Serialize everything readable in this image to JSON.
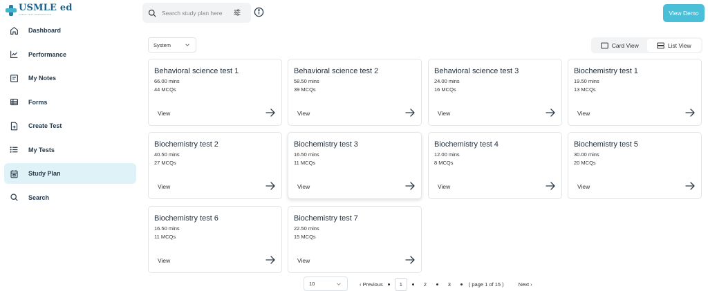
{
  "app": {
    "logo_text": "USMLE ed",
    "logo_tagline": "USMLE TEST PREPARATION"
  },
  "sidebar": {
    "items": [
      {
        "label": "Dashboard",
        "icon": "home-icon"
      },
      {
        "label": "Performance",
        "icon": "chart-line-icon"
      },
      {
        "label": "My Notes",
        "icon": "notes-icon"
      },
      {
        "label": "Forms",
        "icon": "table-icon"
      },
      {
        "label": "Create Test",
        "icon": "file-plus-icon"
      },
      {
        "label": "My Tests",
        "icon": "list-icon"
      },
      {
        "label": "Study Plan",
        "icon": "calendar-icon",
        "active": true
      },
      {
        "label": "Search",
        "icon": "search-icon"
      }
    ]
  },
  "header": {
    "search_placeholder": "Search study plan here",
    "demo_button": "View Demo"
  },
  "filters": {
    "system_value": "System",
    "card_view_label": "Card View",
    "list_view_label": "List View",
    "active_view": "List View"
  },
  "cards": [
    {
      "title": "Behavioral science test 1",
      "mins": "66.00 mins",
      "mcqs": "44 MCQs",
      "action": "View"
    },
    {
      "title": "Behavioral science test 2",
      "mins": "58.50 mins",
      "mcqs": "39 MCQs",
      "action": "View"
    },
    {
      "title": "Behavioral science test 3",
      "mins": "24.00 mins",
      "mcqs": "16 MCQs",
      "action": "View"
    },
    {
      "title": "Biochemistry test 1",
      "mins": "19.50 mins",
      "mcqs": "13 MCQs",
      "action": "View"
    },
    {
      "title": "Biochemistry test 2",
      "mins": "40.50 mins",
      "mcqs": "27 MCQs",
      "action": "View"
    },
    {
      "title": "Biochemistry test 3",
      "mins": "16.50 mins",
      "mcqs": "11 MCQs",
      "action": "View"
    },
    {
      "title": "Biochemistry test 4",
      "mins": "12.00 mins",
      "mcqs": "8 MCQs",
      "action": "View"
    },
    {
      "title": "Biochemistry test 5",
      "mins": "30.00 mins",
      "mcqs": "20 MCQs",
      "action": "View"
    },
    {
      "title": "Biochemistry test 6",
      "mins": "16.50 mins",
      "mcqs": "11 MCQs",
      "action": "View"
    },
    {
      "title": "Biochemistry test 7",
      "mins": "22.50 mins",
      "mcqs": "15 MCQs",
      "action": "View"
    }
  ],
  "pagination": {
    "page_size": "10",
    "previous_label": "Previous",
    "pages": [
      "1",
      "2",
      "3"
    ],
    "current_page": "1",
    "page_info": "( page 1 of 15 )",
    "next_label": "Next"
  },
  "colors": {
    "accent": "#4cbfd8",
    "active_nav_bg": "#dff2f7",
    "brand": "#1d5f8a"
  }
}
